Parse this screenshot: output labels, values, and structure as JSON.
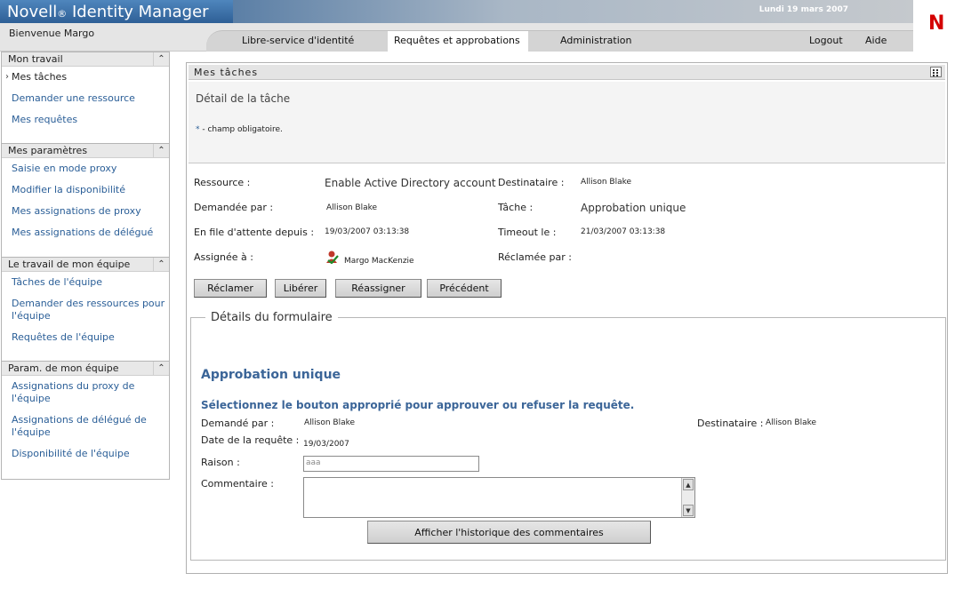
{
  "app": {
    "brand": "Novell",
    "brand_reg": "®",
    "product": " Identity Manager",
    "date": "Lundi 19 mars 2007",
    "logo": "N",
    "welcome": "Bienvenue Margo"
  },
  "nav": {
    "tabs": [
      {
        "label": "Libre-service d'identité"
      },
      {
        "label": "Requêtes et approbations"
      },
      {
        "label": "Administration"
      }
    ],
    "logout": "Logout",
    "help": "Aide"
  },
  "sidebar": {
    "sections": [
      {
        "title": "Mon travail",
        "items": [
          "Mes tâches",
          "Demander une ressource",
          "Mes requêtes"
        ]
      },
      {
        "title": "Mes paramètres",
        "items": [
          "Saisie en mode proxy",
          "Modifier la disponibilité",
          "Mes assignations de proxy",
          "Mes assignations de délégué"
        ]
      },
      {
        "title": "Le travail de mon équipe",
        "items": [
          "Tâches de l'équipe",
          "Demander des ressources pour l'équipe",
          "Requêtes de l'équipe"
        ]
      },
      {
        "title": "Param. de mon équipe",
        "items": [
          "Assignations du proxy de l'équipe",
          "Assignations de délégué de l'équipe",
          "Disponibilité de l'équipe"
        ]
      }
    ]
  },
  "main": {
    "title": "Mes tâches",
    "detail_title": "Détail de la tâche",
    "required_star": "*",
    "required_note": " - champ obligatoire.",
    "task": {
      "resource_label": "Ressource :",
      "resource_value": "Enable Active Directory account",
      "recipient_label": "Destinataire :",
      "recipient_value": "Allison Blake",
      "requested_by_label": "Demandée par :",
      "requested_by_value": "Allison Blake",
      "task_label": "Tâche :",
      "task_value": "Approbation unique",
      "queued_label": "En file d'attente depuis :",
      "queued_value": "19/03/2007 03:13:38",
      "timeout_label": "Timeout le :",
      "timeout_value": "21/03/2007 03:13:38",
      "assigned_label": "Assignée à :",
      "assigned_value": "Margo MacKenzie",
      "claimed_label": "Réclamée par :"
    },
    "buttons": {
      "claim": "Réclamer",
      "release": "Libérer",
      "reassign": "Réassigner",
      "previous": "Précédent"
    },
    "form": {
      "legend": "Détails du formulaire",
      "heading": "Approbation unique",
      "instruction": "Sélectionnez le bouton approprié pour approuver ou refuser la requête.",
      "requested_by_label": "Demandé par :",
      "requested_by_value": "Allison Blake",
      "recipient_label": "Destinataire :",
      "recipient_value": "Allison Blake",
      "request_date_label": "Date de la requête :",
      "request_date_value": "19/03/2007",
      "reason_label": "Raison :",
      "reason_value": "aaa",
      "comment_label": "Commentaire :",
      "comment_value": "",
      "history_button": "Afficher l'historique des commentaires"
    }
  }
}
